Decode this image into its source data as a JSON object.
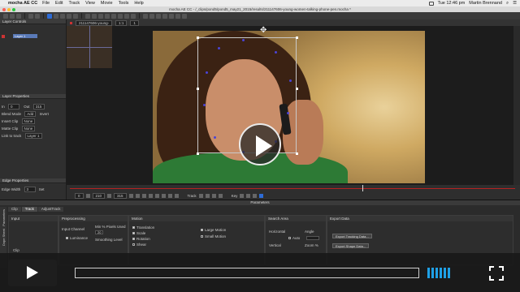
{
  "menubar": {
    "app": "mocha AE CC",
    "items": [
      "File",
      "Edit",
      "Track",
      "View",
      "Movie",
      "Tools",
      "Help"
    ],
    "clock": "Tue 12:46 pm",
    "user": "Martin Brennand"
  },
  "window": {
    "title": "mocha AE CC - /_clips/pond5/pond5_may21_2015/results/211147606-young-women-talking-phone-pen.mocha *"
  },
  "panels": {
    "layer_controls": "Layer Controls",
    "layer_name": "Layer 1",
    "layer_properties": "Layer Properties",
    "in_label": "In",
    "in_value": "0",
    "out_label": "Out",
    "out_value": "315",
    "blend_mode_label": "Blend Mode",
    "blend_mode_value": "Add",
    "invert_label": "Invert",
    "insert_clip_label": "Insert Clip",
    "insert_clip_value": "None",
    "matte_clip_label": "Matte Clip",
    "matte_clip_value": "None",
    "link_to_track_label": "Link to track",
    "link_to_track_value": "Layer 1",
    "edge_properties": "Edge Properties",
    "edge_width_label": "Edge Width",
    "edge_width_value": "3",
    "set_label": "Set"
  },
  "viewer": {
    "clip_name": "211147606-young-",
    "zoom_a": "1:1",
    "zoom_b": "1"
  },
  "timeline": {
    "start": "0",
    "current": "210",
    "end": "315",
    "track_label": "Track",
    "key_label": "Key"
  },
  "parameters": {
    "title": "Parameters",
    "tabs": [
      "Clip",
      "Track",
      "AdjustTrack"
    ],
    "vertical_tabs": [
      "Parameters",
      "Dope Sheet"
    ],
    "input": "Input",
    "clip_label": "Clip",
    "clip_value": "211147606-young",
    "preprocessing": "Preprocessing",
    "input_channel": "Input Channel",
    "luminance": "Luminance",
    "min_pixels_used": "Min % Pixels Used",
    "min_pixels_value": "20",
    "smoothing_level": "Smoothing Level",
    "motion": "Motion",
    "translation": "Translation",
    "scale": "Scale",
    "rotation": "Rotation",
    "shear": "Shear",
    "large_motion": "Large Motion",
    "small_motion": "Small Motion",
    "search_area": "Search Area",
    "horizontal": "Horizontal",
    "angle": "Angle",
    "auto": "Auto",
    "vertical": "Vertical",
    "zoom_pct": "Zoom %",
    "export_data": "Export Data",
    "export_tracking": "Export Tracking Data...",
    "export_shape": "Export Shape Data..."
  },
  "player": {
    "progress": 0.0,
    "volume_bars": 6
  },
  "colors": {
    "accent_blue": "#2d6bd6",
    "timeline_red": "#b62222",
    "volume_blue": "#1fa0e6",
    "track_point": "#4b44d6"
  }
}
